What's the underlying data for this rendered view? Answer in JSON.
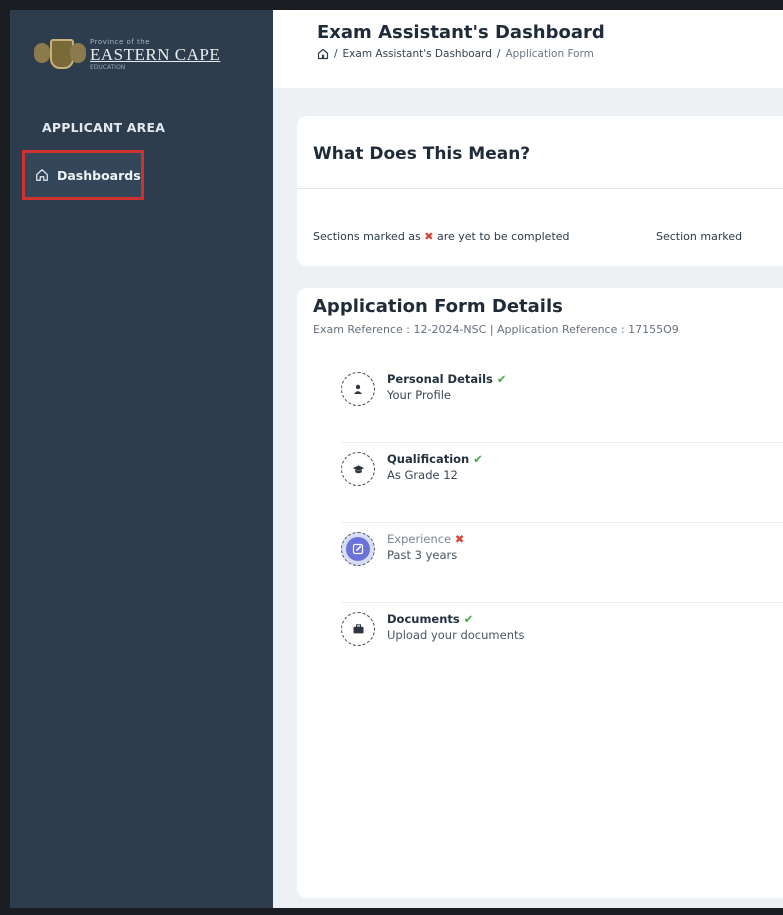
{
  "brand": {
    "small": "Province of the",
    "main": "EASTERN CAPE",
    "sub": "EDUCATION"
  },
  "sidebar": {
    "section_label": "APPLICANT AREA",
    "items": [
      {
        "label": "Dashboards",
        "icon": "home-outline-icon",
        "selected": true
      }
    ]
  },
  "header": {
    "title": "Exam Assistant's Dashboard",
    "breadcrumb": [
      {
        "label": "home-icon"
      },
      {
        "label": "Exam Assistant's Dashboard"
      },
      {
        "label": "Application Form"
      }
    ],
    "separator": "/"
  },
  "legend_card": {
    "title": "What Does This Mean?",
    "left_text_before": "Sections marked as ",
    "left_mark": "✖",
    "left_text_after": " are yet to be completed",
    "right_text": "Section marked"
  },
  "form": {
    "title": "Application Form Details",
    "reference": "Exam Reference : 12-2024-NSC | Application Reference : 17155O9",
    "steps": [
      {
        "title": "Personal Details",
        "status_mark": "✔",
        "subtitle": "Your Profile",
        "icon": "user-icon",
        "status": "complete"
      },
      {
        "title": "Qualification",
        "status_mark": "✔",
        "subtitle": "As Grade 12",
        "icon": "graduation-cap-icon",
        "status": "complete"
      },
      {
        "title": "Experience",
        "status_mark": "✖",
        "subtitle": "Past 3 years",
        "icon": "edit-icon",
        "status": "incomplete"
      },
      {
        "title": "Documents",
        "status_mark": "✔",
        "subtitle": "Upload your documents",
        "icon": "briefcase-icon",
        "status": "complete"
      }
    ]
  },
  "colors": {
    "sidebar_bg": "#2e3d4d",
    "highlight_border": "#d0312d",
    "check": "#4aa84a",
    "cross": "#d6453b",
    "active_step": "#6a74d8"
  }
}
